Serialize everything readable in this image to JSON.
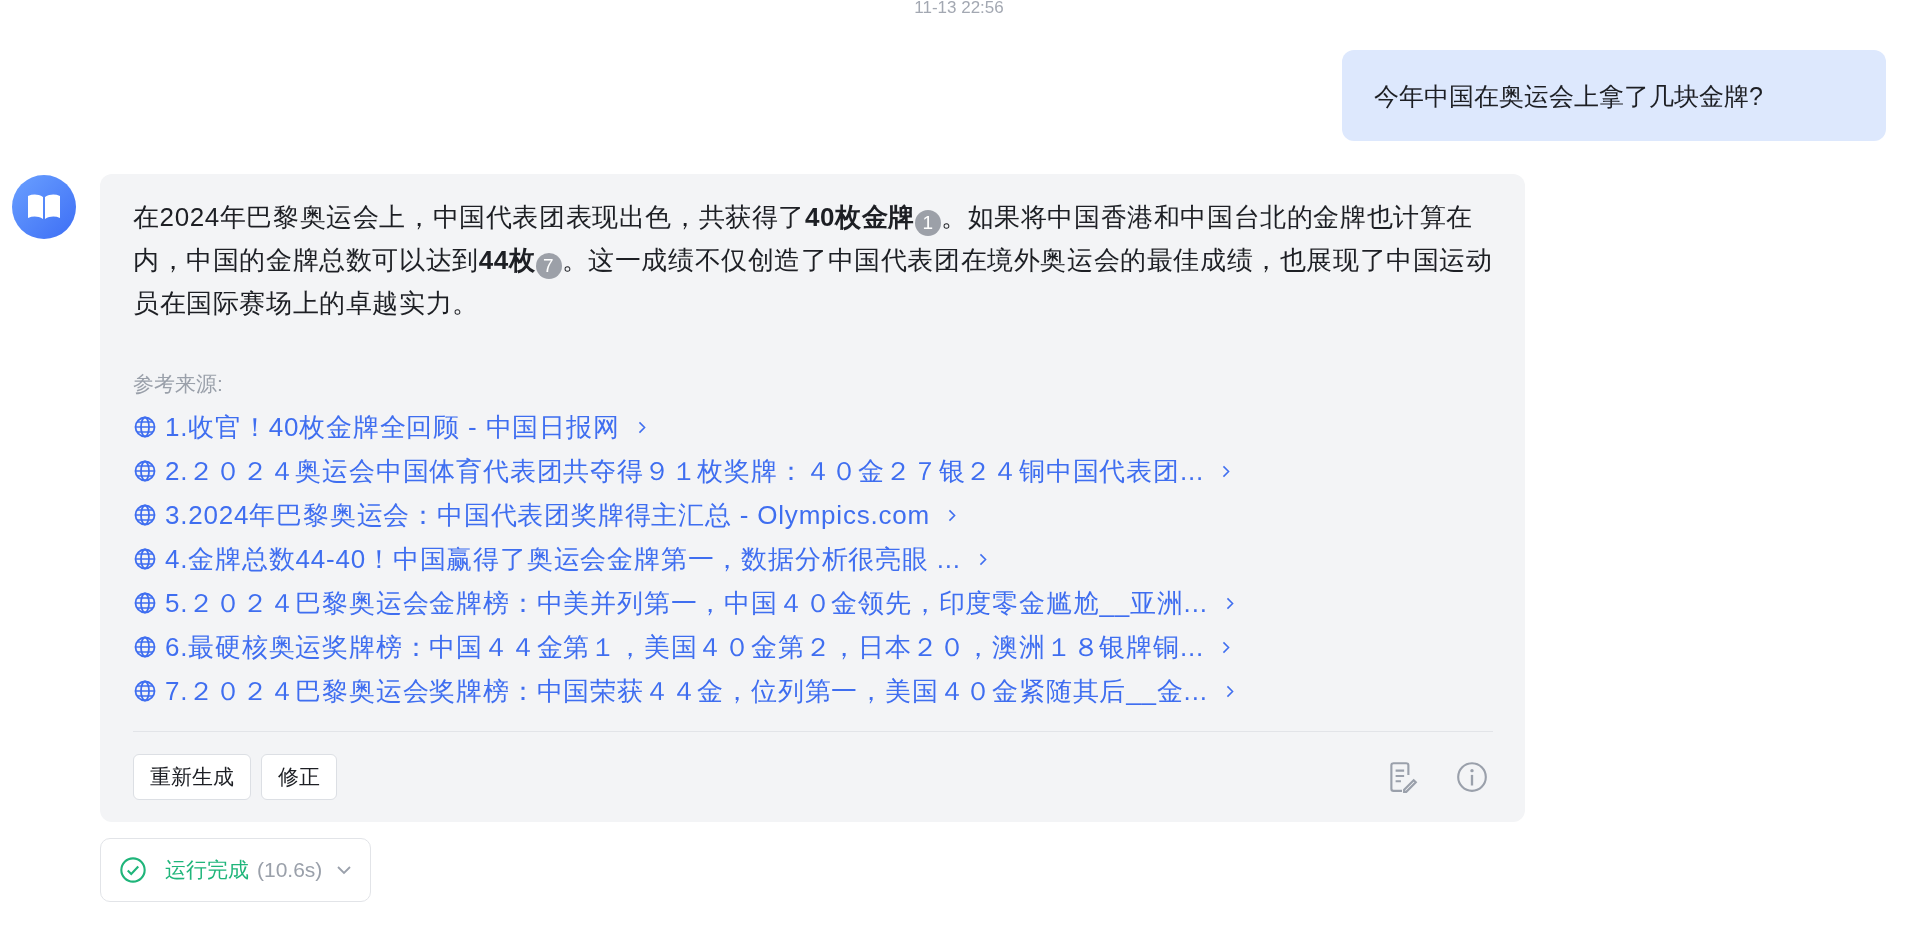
{
  "timestamp": "11-13 22:56",
  "user_message": "今年中国在奥运会上拿了几块金牌?",
  "answer": {
    "segments": [
      {
        "kind": "text",
        "text": "在2024年巴黎奥运会上，中国代表团表现出色，共获得了"
      },
      {
        "kind": "bold",
        "text": "40枚金牌"
      },
      {
        "kind": "cite",
        "text": "1"
      },
      {
        "kind": "text",
        "text": "。如果将中国香港和中国台北的金牌也计算在内，中国的金牌总数可以达到"
      },
      {
        "kind": "bold",
        "text": "44枚"
      },
      {
        "kind": "cite",
        "text": "7"
      },
      {
        "kind": "text",
        "text": "。这一成绩不仅创造了中国代表团在境外奥运会的最佳成绩，也展现了中国运动员在国际赛场上的卓越实力。"
      }
    ],
    "sources_label": "参考来源:",
    "sources": [
      "1.收官！40枚金牌全回顾 - 中国日报网",
      "2.２０２４奥运会中国体育代表团共夺得９１枚奖牌：４０金２７银２４铜中国代表团...",
      "3.2024年巴黎奥运会：中国代表团奖牌得主汇总 - Olympics.com",
      "4.金牌总数44-40！中国赢得了奥运会金牌第一，数据分析很亮眼 ...",
      "5.２０２４巴黎奥运会金牌榜：中美并列第一，中国４０金领先，印度零金尴尬__亚洲...",
      "6.最硬核奥运奖牌榜：中国４４金第１，美国４０金第２，日本２０，澳洲１８银牌铜...",
      "7.２０２４巴黎奥运会奖牌榜：中国荣获４４金，位列第一，美国４０金紧随其后__金..."
    ],
    "buttons": [
      "重新生成",
      "修正"
    ]
  },
  "run_status": {
    "label": "运行完成",
    "duration": "(10.6s)"
  }
}
